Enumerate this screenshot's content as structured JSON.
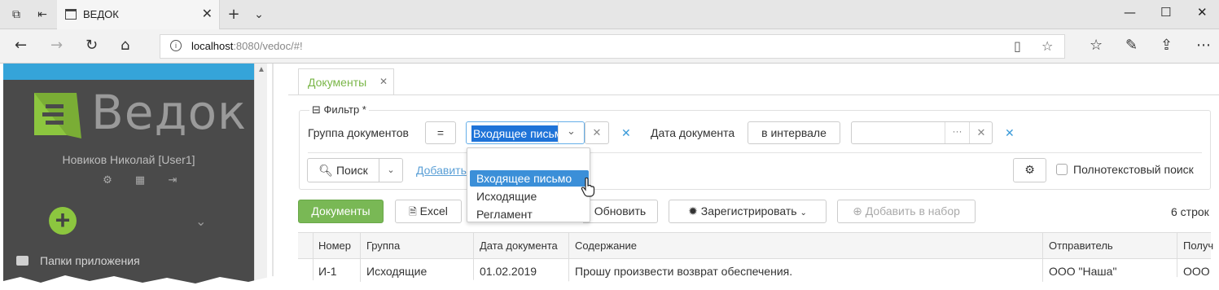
{
  "browser": {
    "tab_title": "ВЕДОК",
    "url_host": "localhost",
    "url_path": ":8080/vedoc/#!"
  },
  "sidebar": {
    "app_name": "Ведок",
    "user": "Новиков Николай [User1]",
    "folders_label": "Папки приложения",
    "accent_color": "#35a4d9",
    "logo_color": "#8cc63f"
  },
  "content": {
    "tab_label": "Документы",
    "filter": {
      "legend": "Фильтр *",
      "group_label": "Группа документов",
      "group_operator": "=",
      "group_value": "Входящее письмо",
      "date_label": "Дата документа",
      "date_operator": "в интервале",
      "date_value": "",
      "search_label": "Поиск",
      "add_label": "Добавить",
      "fulltext_label": "Полнотекстовый поиск"
    },
    "dropdown_options": [
      "Входящее письмо",
      "Исходящие",
      "Регламент"
    ],
    "toolbar": {
      "documents": "Документы",
      "excel": "Excel",
      "refresh": "Обновить",
      "register": "Зарегистрировать",
      "add_to_set": "Добавить в набор",
      "row_count": "6 строк"
    },
    "table": {
      "columns": [
        "Номер",
        "Группа",
        "Дата документа",
        "Содержание",
        "Отправитель",
        "Получ"
      ],
      "rows": [
        [
          "И-1",
          "Исходящие",
          "01.02.2019",
          "Прошу произвести возврат обеспечения.",
          "ООО \"Наша\"",
          "ООО"
        ]
      ]
    }
  }
}
